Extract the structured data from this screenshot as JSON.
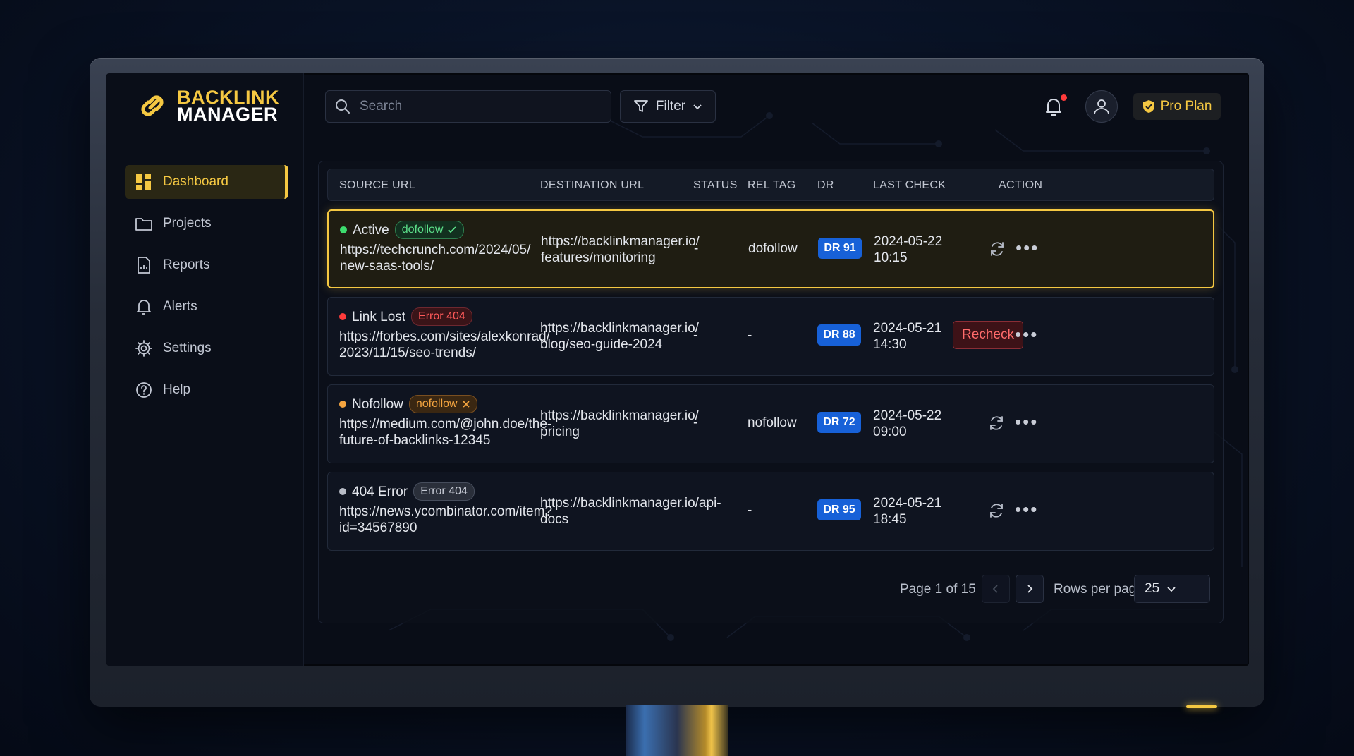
{
  "app": {
    "logo_line1": "BACKLINK",
    "logo_line2": "MANAGER",
    "accent_color": "#f5c842"
  },
  "sidebar": {
    "items": [
      {
        "label": "Dashboard",
        "icon": "dashboard-grid-icon",
        "active": true
      },
      {
        "label": "Projects",
        "icon": "folder-icon"
      },
      {
        "label": "Reports",
        "icon": "report-document-icon"
      },
      {
        "label": "Alerts",
        "icon": "bell-icon"
      },
      {
        "label": "Settings",
        "icon": "gear-icon"
      },
      {
        "label": "Help",
        "icon": "help-circle-icon"
      }
    ]
  },
  "topbar": {
    "search_placeholder": "Search",
    "filter_label": "Filter",
    "plan_label": "Pro Plan"
  },
  "table": {
    "columns": [
      "SOURCE URL",
      "DESTINATION URL",
      "STATUS",
      "REL TAG",
      "DR",
      "LAST CHECK",
      "ACTION"
    ],
    "rows": [
      {
        "status_label": "Active",
        "status_color": "#3ddc6e",
        "chip": "dofollow",
        "chip_style": "green",
        "chip_icon": "check-icon",
        "source_line1": "https://techcrunch.com/2024/05/",
        "source_line2": "new-saas-tools/",
        "dest_line1": "https://backlinkmanager.io/",
        "dest_line2": "features/monitoring",
        "status": "-",
        "rel": "dofollow",
        "dr": "DR 91",
        "date": "2024-05-22",
        "time": "10:15",
        "action": "refresh"
      },
      {
        "status_label": "Link Lost",
        "status_color": "#ff3b3b",
        "chip": "Error 404",
        "chip_style": "red",
        "source_line1": "https://forbes.com/sites/alexkonrad/",
        "source_line2": "2023/11/15/seo-trends/",
        "dest_line1": "https://backlinkmanager.io/",
        "dest_line2": "blog/seo-guide-2024",
        "status": "-",
        "rel": "-",
        "dr": "DR 88",
        "date": "2024-05-21",
        "time": "14:30",
        "action": "Recheck"
      },
      {
        "status_label": "Nofollow",
        "status_color": "#f5a540",
        "chip": "nofollow",
        "chip_style": "orange",
        "chip_icon": "x-icon",
        "source_line1": "https://medium.com/@john.doe/the-",
        "source_line2": "future-of-backlinks-12345",
        "dest_line1": "https://backlinkmanager.io/",
        "dest_line2": "pricing",
        "status": "-",
        "rel": "nofollow",
        "dr": "DR 72",
        "date": "2024-05-22",
        "time": "09:00",
        "action": "refresh"
      },
      {
        "status_label": "404 Error",
        "status_color": "#b8bcc6",
        "chip": "Error 404",
        "chip_style": "grey",
        "source_line1": "https://news.ycombinator.com/item?",
        "source_line2": "id=34567890",
        "dest_line1": "https://backlinkmanager.io/api-",
        "dest_line2": "docs",
        "status": "",
        "rel": "-",
        "dr": "DR 95",
        "date": "2024-05-21",
        "time": "18:45",
        "action": "refresh"
      }
    ]
  },
  "pagination": {
    "page_text": "Page 1 of 15",
    "rows_label": "Rows per page:",
    "rows_value": "25"
  }
}
